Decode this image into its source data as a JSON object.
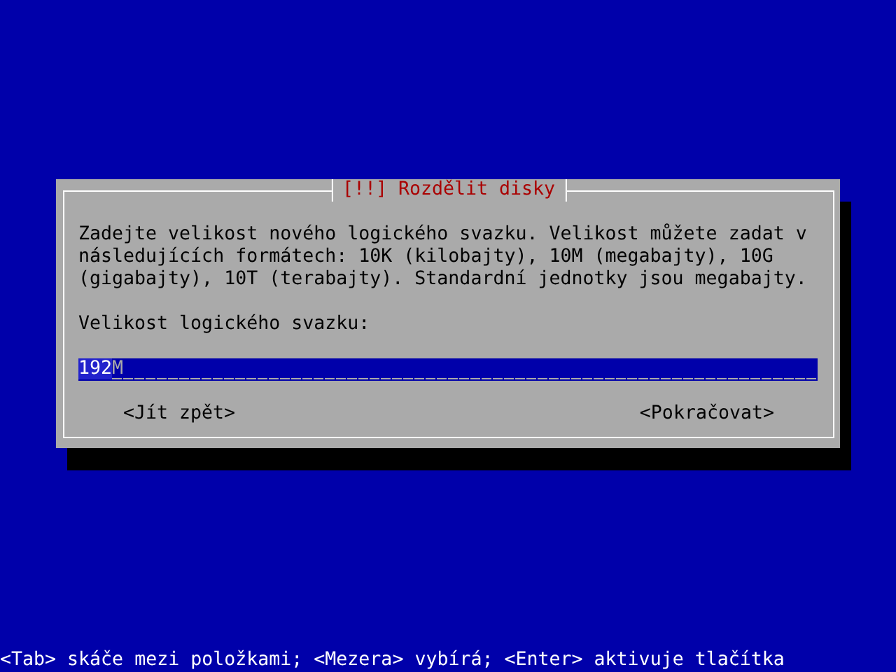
{
  "dialog": {
    "title": "[!!] Rozdělit disky",
    "message": "Zadejte velikost nového logického svazku. Velikost můžete zadat v následujících formátech: 10K (kilobajty), 10M (megabajty), 10G (gigabajty), 10T (terabajty). Standardní jednotky jsou megabajty.",
    "field_label": "Velikost logického svazku:",
    "field": {
      "value_selected": "192",
      "value_rest": "M"
    },
    "buttons": [
      {
        "label": "<Jít zpět>"
      },
      {
        "label": "<Pokračovat>"
      }
    ]
  },
  "status_bar": "<Tab> skáče mezi položkami; <Mezera> vybírá; <Enter> aktivuje tlačítka"
}
